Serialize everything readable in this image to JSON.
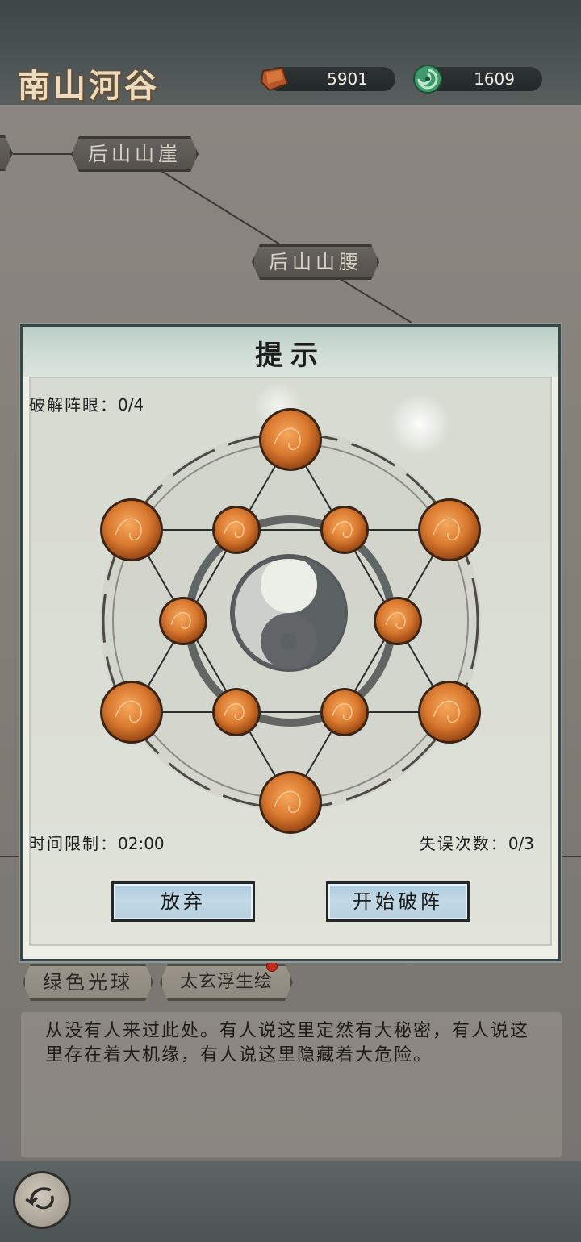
{
  "header": {
    "location": "南山河谷",
    "currencies": [
      {
        "name": "gold-ingot",
        "value": "5901",
        "color": "#b8572b"
      },
      {
        "name": "jade-coin",
        "value": "1609",
        "color": "#3e9a6a"
      }
    ]
  },
  "map": {
    "nodes": [
      {
        "label": ""
      },
      {
        "label": "后山山崖"
      },
      {
        "label": "后山山腰"
      }
    ]
  },
  "dialog": {
    "title": "提示",
    "progress_label": "破解阵眼：",
    "progress_value": "0/4",
    "timer_label": "时间限制：",
    "timer_value": "02:00",
    "mistakes_label": "失误次数：",
    "mistakes_value": "0/3",
    "buttons": {
      "give_up": "放弃",
      "start": "开始破阵"
    },
    "orb_color": "#d9792f",
    "orb_count": 12
  },
  "tags": {
    "green_orb": "绿色光球",
    "painting": "太玄浮生绘"
  },
  "description": "从没有人来过此处。有人说这里定然有大秘密，有人说这里存在着大机缘，有人说这里隐藏着大危险。"
}
